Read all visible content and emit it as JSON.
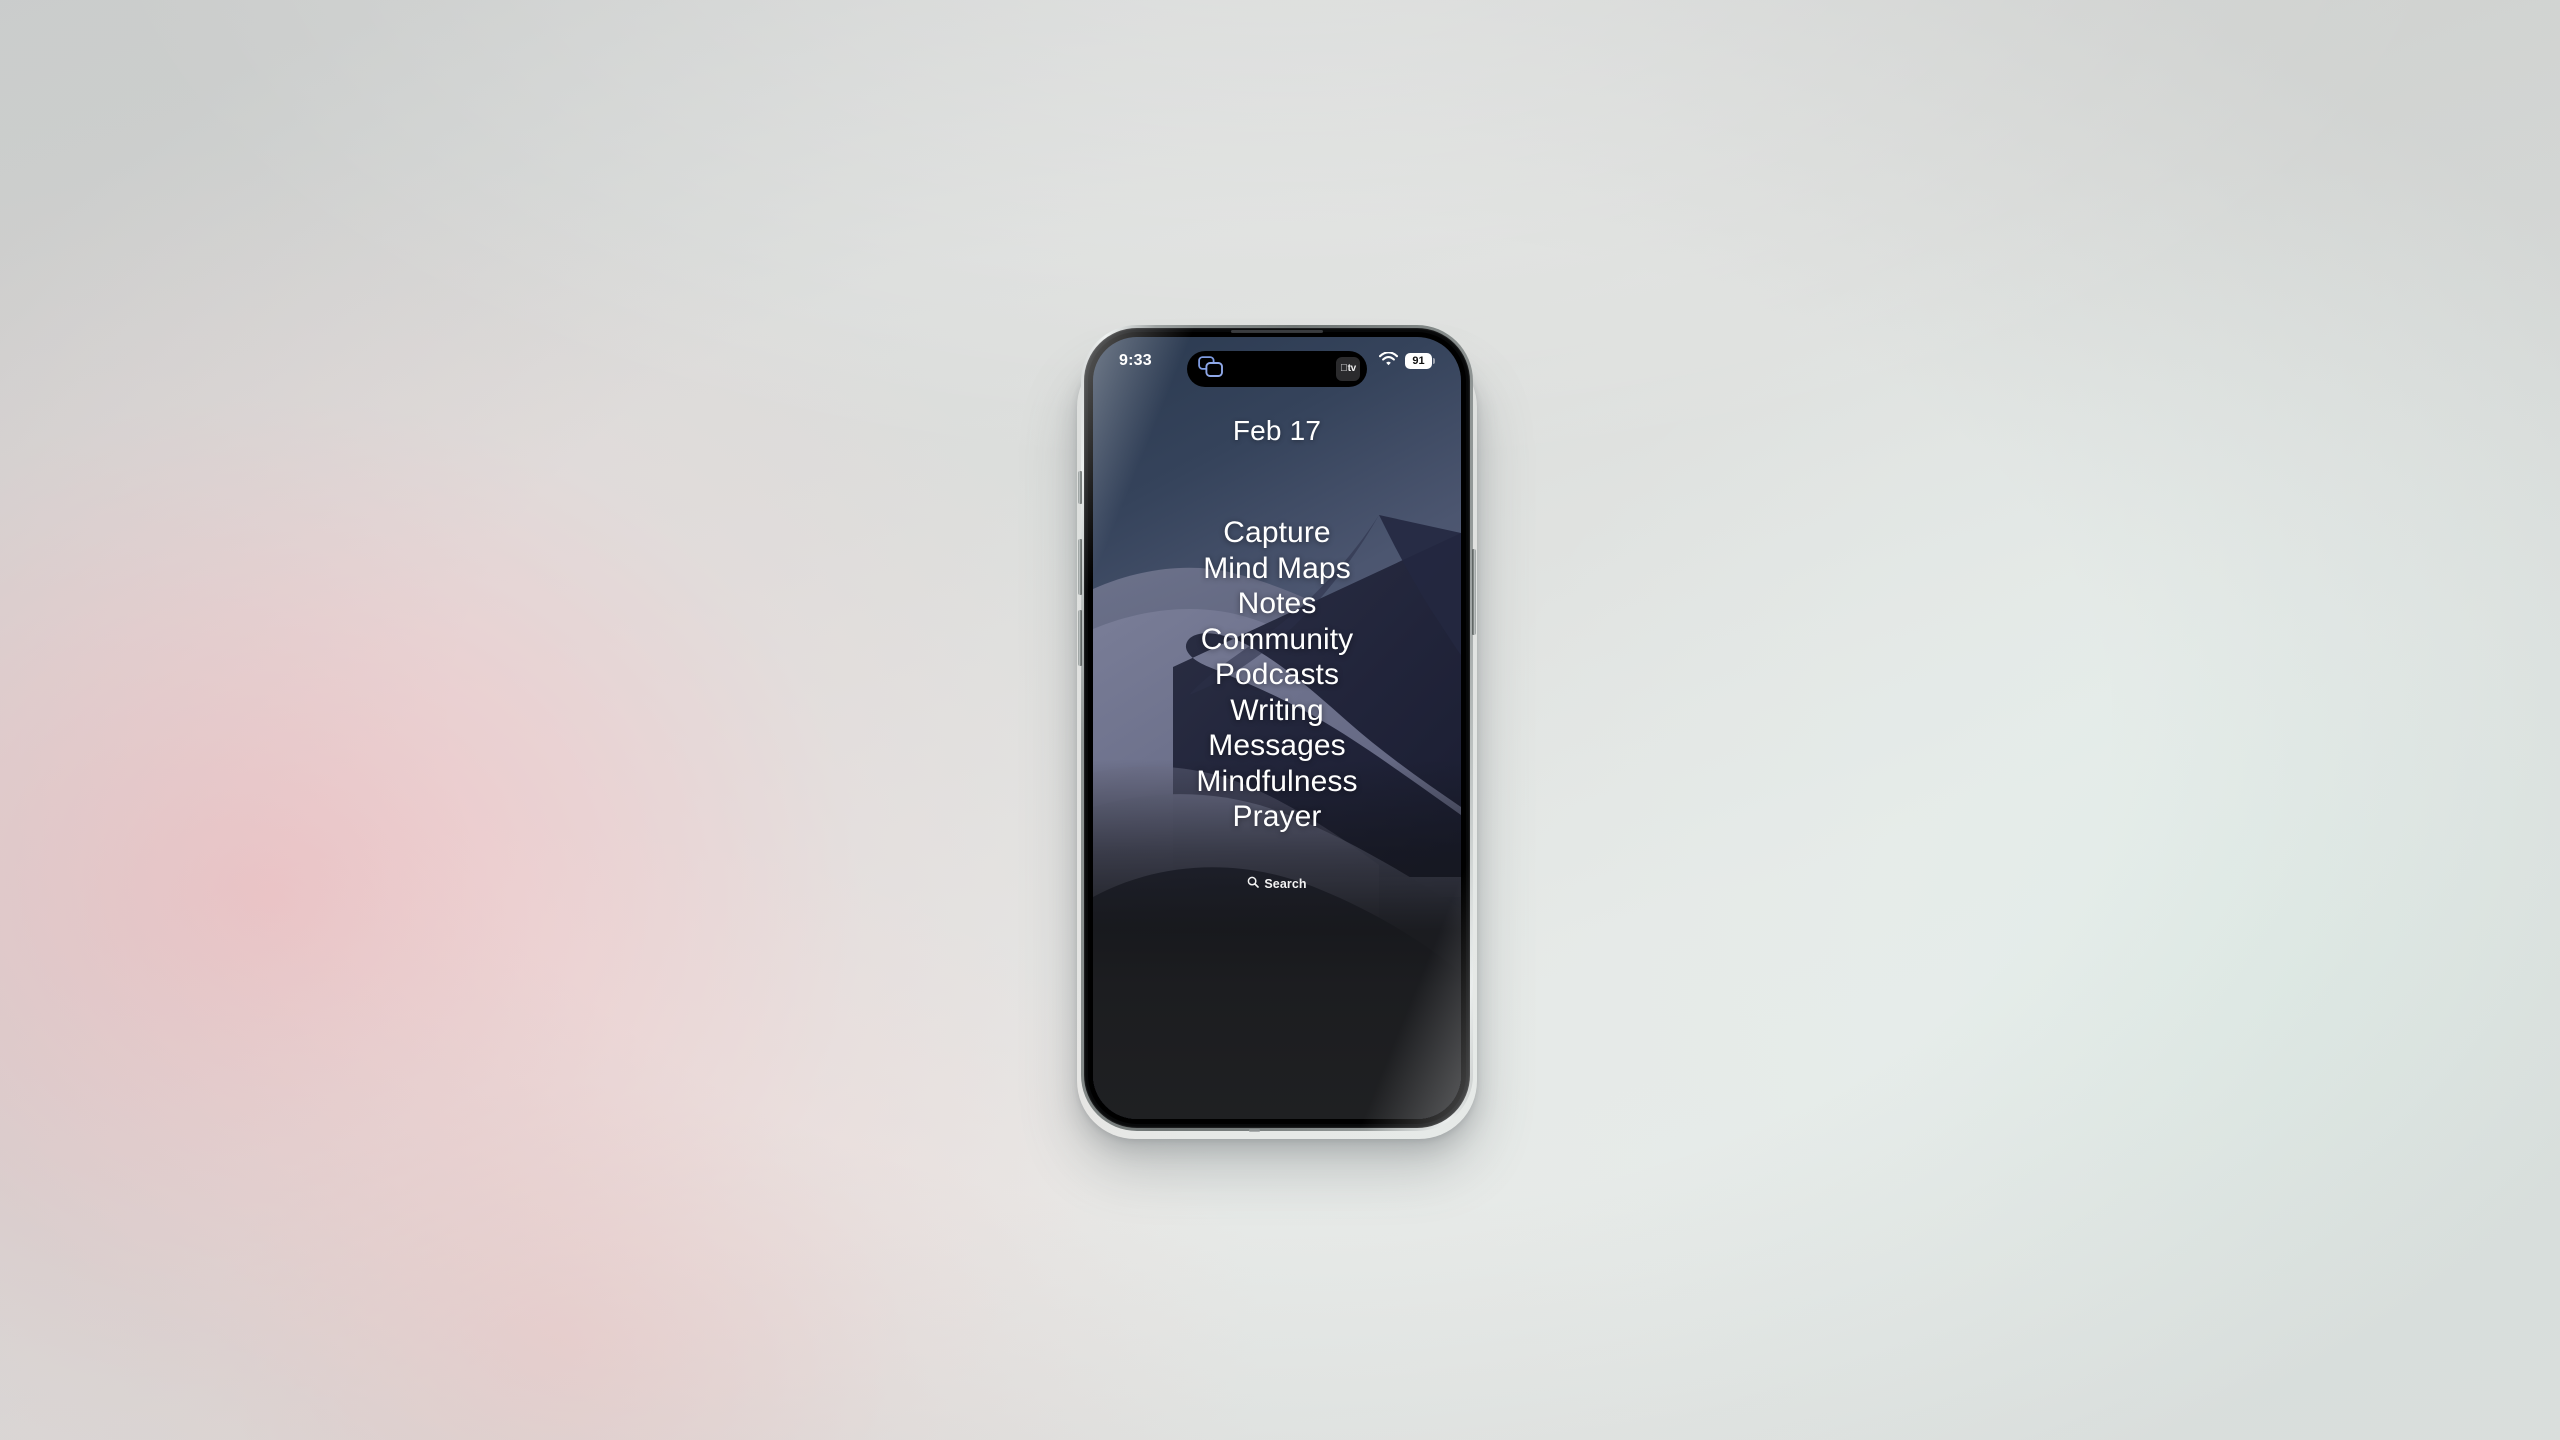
{
  "scene": {
    "surface_description": "soft studio gradient backdrop",
    "backdrop_colors": {
      "gray": "#d5d7d6",
      "pink": "#ebd2d4",
      "mint": "#e7ebe9",
      "white_highlight": "#f1f3f2"
    },
    "device": "iphone-titanium-black"
  },
  "status_bar": {
    "time": "9:33",
    "wifi_icon": "wifi-icon",
    "battery_percent": "91",
    "battery_icon": "battery-icon"
  },
  "dynamic_island": {
    "left_icon": "screen-mirroring-icon",
    "right_app_badge": {
      "apple_logo": "",
      "label": "tv"
    }
  },
  "lock_screen": {
    "date": "Feb 17",
    "menu": {
      "items": [
        {
          "label": "Capture"
        },
        {
          "label": "Mind Maps"
        },
        {
          "label": "Notes"
        },
        {
          "label": "Community"
        },
        {
          "label": "Podcasts"
        },
        {
          "label": "Writing"
        },
        {
          "label": "Messages"
        },
        {
          "label": "Mindfulness"
        },
        {
          "label": "Prayer"
        }
      ]
    },
    "search": {
      "icon": "search-icon",
      "label": "Search"
    },
    "wallpaper": {
      "name": "night-desert-dunes",
      "sky_top": "#2f3f55",
      "sky_bottom": "#575f75",
      "dune_light": "#70748e",
      "dune_mid": "#5a5f78",
      "dune_dark": "#232739",
      "dune_shadow": "#1a1c2b"
    }
  },
  "hardware": {
    "action_button": "action-button",
    "volume_up_button": "volume-up-button",
    "volume_down_button": "volume-down-button",
    "power_button": "power-button",
    "speaker": "earpiece-speaker"
  }
}
